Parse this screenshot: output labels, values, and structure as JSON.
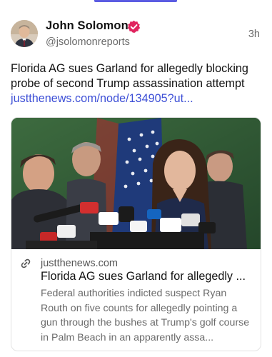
{
  "post": {
    "author": {
      "name": "John Solomon",
      "handle": "@jsolomonreports",
      "verified": true,
      "avatar_icon": "user-avatar"
    },
    "timestamp": "3h",
    "text": "Florida AG sues Garland for allegedly blocking probe of second Trump assassination attempt",
    "link_text": "justthenews.com/node/134905?ut..."
  },
  "card": {
    "image_icon": "press-conference-photo",
    "domain": "justthenews.com",
    "title": "Florida AG sues Garland for allegedly ...",
    "description": "Federal authorities indicted suspect Ryan Routh on five counts for allegedly pointing a gun through the bushes at Trump's golf course in Palm Beach in an apparently assa...",
    "link_icon": "link-icon"
  },
  "colors": {
    "link": "#3d4fd6",
    "verified_badge": "#e0245e",
    "accent": "#5b5ce2",
    "secondary_text": "#6b6b6b"
  }
}
